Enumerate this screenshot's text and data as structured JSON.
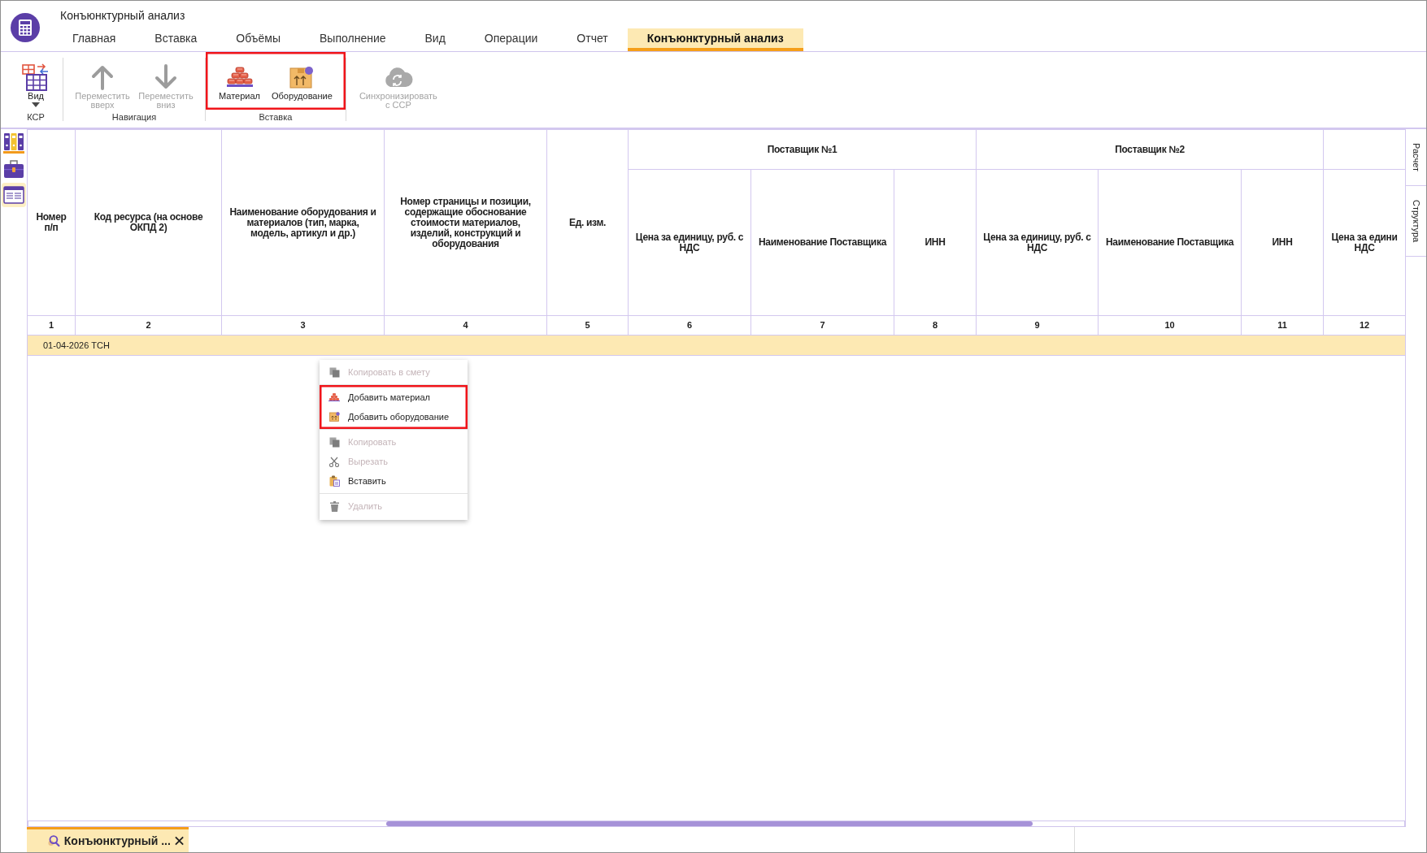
{
  "window": {
    "title": "Конъюнктурный анализ"
  },
  "tabs": [
    {
      "label": "Главная",
      "selected": false
    },
    {
      "label": "Вставка",
      "selected": false
    },
    {
      "label": "Объёмы",
      "selected": false
    },
    {
      "label": "Выполнение",
      "selected": false
    },
    {
      "label": "Вид",
      "selected": false
    },
    {
      "label": "Операции",
      "selected": false
    },
    {
      "label": "Отчет",
      "selected": false
    },
    {
      "label": "Конъюнктурный анализ",
      "selected": true
    }
  ],
  "ribbon": {
    "groups": [
      {
        "label": "КСР",
        "highlighted": false,
        "buttons": [
          {
            "kind": "view",
            "label": "Вид",
            "disabled": false,
            "dropdown": true
          }
        ]
      },
      {
        "label": "Навигация",
        "highlighted": false,
        "buttons": [
          {
            "kind": "up",
            "label": "Переместить вверх",
            "disabled": true,
            "dropdown": false
          },
          {
            "kind": "down",
            "label": "Переместить вниз",
            "disabled": true,
            "dropdown": false
          }
        ]
      },
      {
        "label": "Вставка",
        "highlighted": true,
        "buttons": [
          {
            "kind": "material",
            "label": "Материал",
            "disabled": false,
            "dropdown": false
          },
          {
            "kind": "equipment",
            "label": "Оборудование",
            "disabled": false,
            "dropdown": false
          }
        ]
      },
      {
        "highlighted": false,
        "buttons": [
          {
            "kind": "sync",
            "label": "Синхронизировать с ССР",
            "disabled": true,
            "dropdown": false
          }
        ]
      }
    ]
  },
  "sidebar": {
    "items": [
      {
        "kind": "binders",
        "selected": false
      },
      {
        "kind": "briefcase",
        "selected": false
      },
      {
        "kind": "sheet",
        "selected": true
      }
    ]
  },
  "table": {
    "columns": [
      {
        "title": "Номер п/п",
        "number": "1"
      },
      {
        "title": "Код ресурса (на основе ОКПД 2)",
        "number": "2"
      },
      {
        "title": "Наименование оборудования и материалов (тип, марка, модель, артикул и др.)",
        "number": "3"
      },
      {
        "title": "Номер страницы и позиции, содержащие обоснование стоимости материалов, изделий, конструкций и оборудования",
        "number": "4"
      },
      {
        "title": "Ед. изм.",
        "number": "5"
      }
    ],
    "column_groups": [
      {
        "title": "Поставщик №1",
        "columns": [
          {
            "title": "Цена за единицу, руб. с НДС",
            "number": "6"
          },
          {
            "title": "Наименование Поставщика",
            "number": "7"
          },
          {
            "title": "ИНН",
            "number": "8"
          }
        ]
      },
      {
        "title": "Поставщик №2",
        "columns": [
          {
            "title": "Цена за единицу, руб. с НДС",
            "number": "9"
          },
          {
            "title": "Наименование Поставщика",
            "number": "10"
          },
          {
            "title": "ИНН",
            "number": "11"
          }
        ]
      },
      {
        "columns": [
          {
            "title": "Цена за едини НДС",
            "number": "12"
          }
        ]
      }
    ],
    "rows": [
      {
        "kind": "group",
        "label": "01-04-2026 ТСН"
      }
    ]
  },
  "context_menu": {
    "sections": [
      {
        "highlighted": false,
        "items": [
          {
            "kind": "copy_to_estimate",
            "label": "Копировать в смету",
            "disabled": true
          }
        ]
      },
      {
        "highlighted": true,
        "items": [
          {
            "kind": "add_material",
            "label": "Добавить материал",
            "disabled": false
          },
          {
            "kind": "add_equipment",
            "label": "Добавить оборудование",
            "disabled": false
          }
        ]
      },
      {
        "highlighted": false,
        "items": [
          {
            "kind": "copy",
            "label": "Копировать",
            "disabled": true
          },
          {
            "kind": "cut",
            "label": "Вырезать",
            "disabled": true
          },
          {
            "kind": "paste",
            "label": "Вставить",
            "disabled": false
          }
        ]
      },
      {
        "highlighted": false,
        "items": [
          {
            "kind": "delete",
            "label": "Удалить",
            "disabled": true
          }
        ]
      }
    ]
  },
  "side_tabs": [
    {
      "label": "Расчет"
    },
    {
      "label": "Структура"
    }
  ],
  "document_tabs": [
    {
      "label": "Конъюнктурный ...",
      "selected": true,
      "closable": true
    }
  ]
}
